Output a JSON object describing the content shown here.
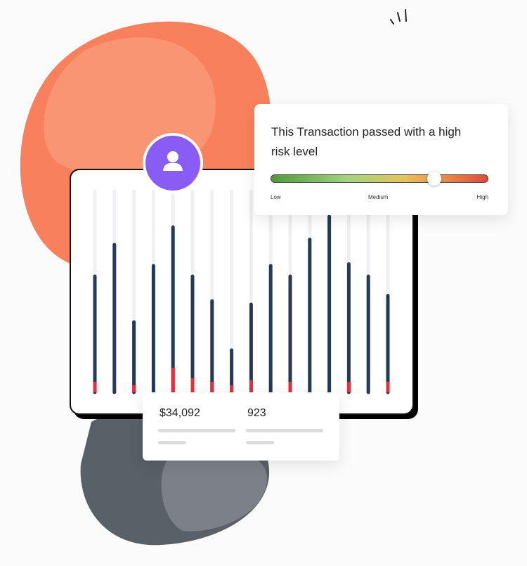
{
  "risk_card": {
    "title": "This Transaction passed with a high risk level",
    "risk_level_percent": 75,
    "scale_labels": [
      "Low",
      "Medium",
      "High"
    ]
  },
  "stats_card": {
    "amount": "$34,092",
    "count": "923"
  },
  "chart": {
    "type": "bar",
    "values": [
      0.66,
      0.84,
      0.4,
      0.72,
      0.94,
      0.66,
      0.52,
      0.24,
      0.5,
      0.72,
      0.66,
      0.87,
      1.0,
      0.73,
      0.66,
      0.55
    ],
    "risk_portion": [
      0.06,
      0,
      0.04,
      0,
      0.14,
      0.08,
      0.06,
      0.04,
      0.07,
      0,
      0.06,
      0,
      0,
      0.06,
      0,
      0.06
    ]
  },
  "colors": {
    "bar": "#253a55",
    "risk": "#e5303c",
    "orange": "#f9805c",
    "accent": "#8a5cf6",
    "gray": "#5a6068"
  }
}
